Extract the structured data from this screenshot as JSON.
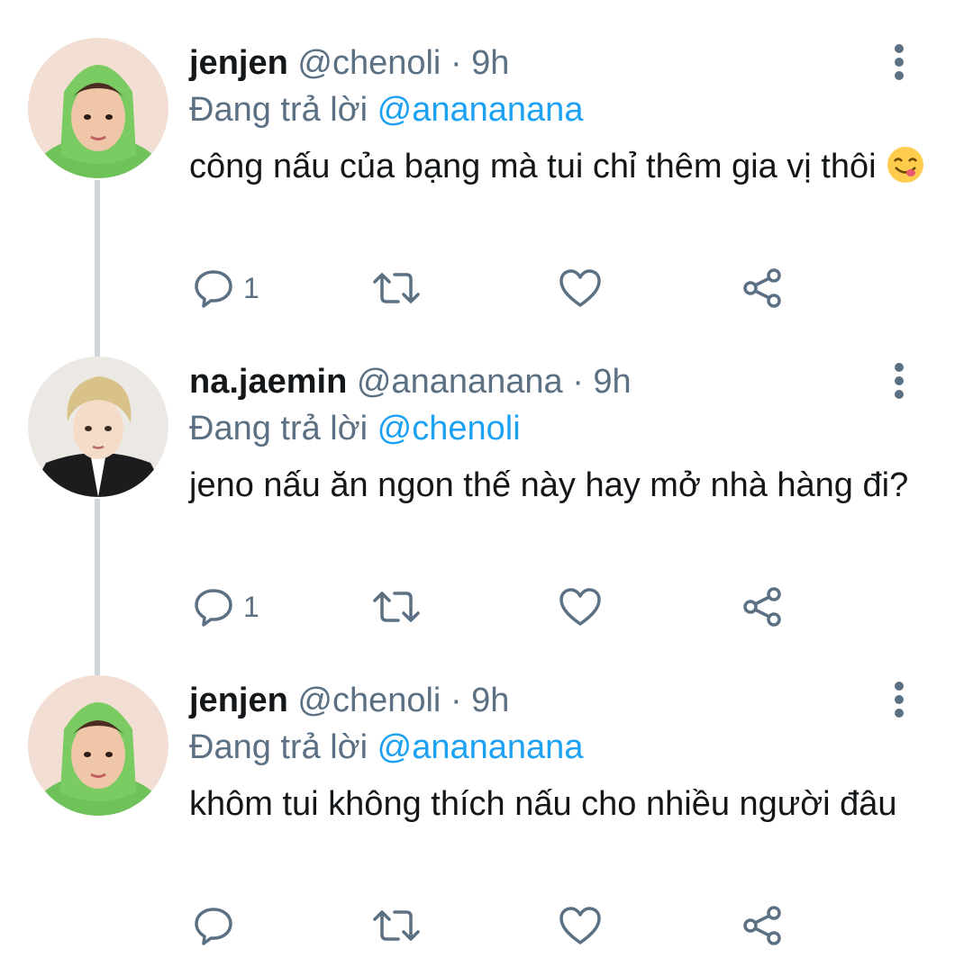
{
  "tweets": [
    {
      "display_name": "jenjen",
      "handle": "@chenoli",
      "separator": "·",
      "time": "9h",
      "replying_prefix": "Đang trả lời",
      "replying_to": "@anananana",
      "text": "công nấu của bạng mà tui chỉ thêm gia vị thôi",
      "emoji": "😋",
      "reply_count": "1",
      "retweet_count": "",
      "like_count": "",
      "avatar_icon": "avatar-green-hoodie"
    },
    {
      "display_name": "na.jaemin",
      "handle": "@anananana",
      "separator": "·",
      "time": "9h",
      "replying_prefix": "Đang trả lời",
      "replying_to": "@chenoli",
      "text": "jeno nấu ăn ngon thế này hay mở nhà hàng đi?",
      "emoji": "",
      "reply_count": "1",
      "retweet_count": "",
      "like_count": "",
      "avatar_icon": "avatar-blond-suit"
    },
    {
      "display_name": "jenjen",
      "handle": "@chenoli",
      "separator": "·",
      "time": "9h",
      "replying_prefix": "Đang trả lời",
      "replying_to": "@anananana",
      "text": "khôm tui không thích nấu cho nhiều người đâu",
      "emoji": "",
      "reply_count": "",
      "retweet_count": "",
      "like_count": "",
      "avatar_icon": "avatar-green-hoodie"
    }
  ],
  "colors": {
    "text": "#14171a",
    "secondary": "#5b7083",
    "mention": "#1da1f2",
    "thread_line": "#d0d5d9"
  },
  "icons": [
    "reply-icon",
    "retweet-icon",
    "like-icon",
    "share-icon",
    "more-options-icon"
  ]
}
